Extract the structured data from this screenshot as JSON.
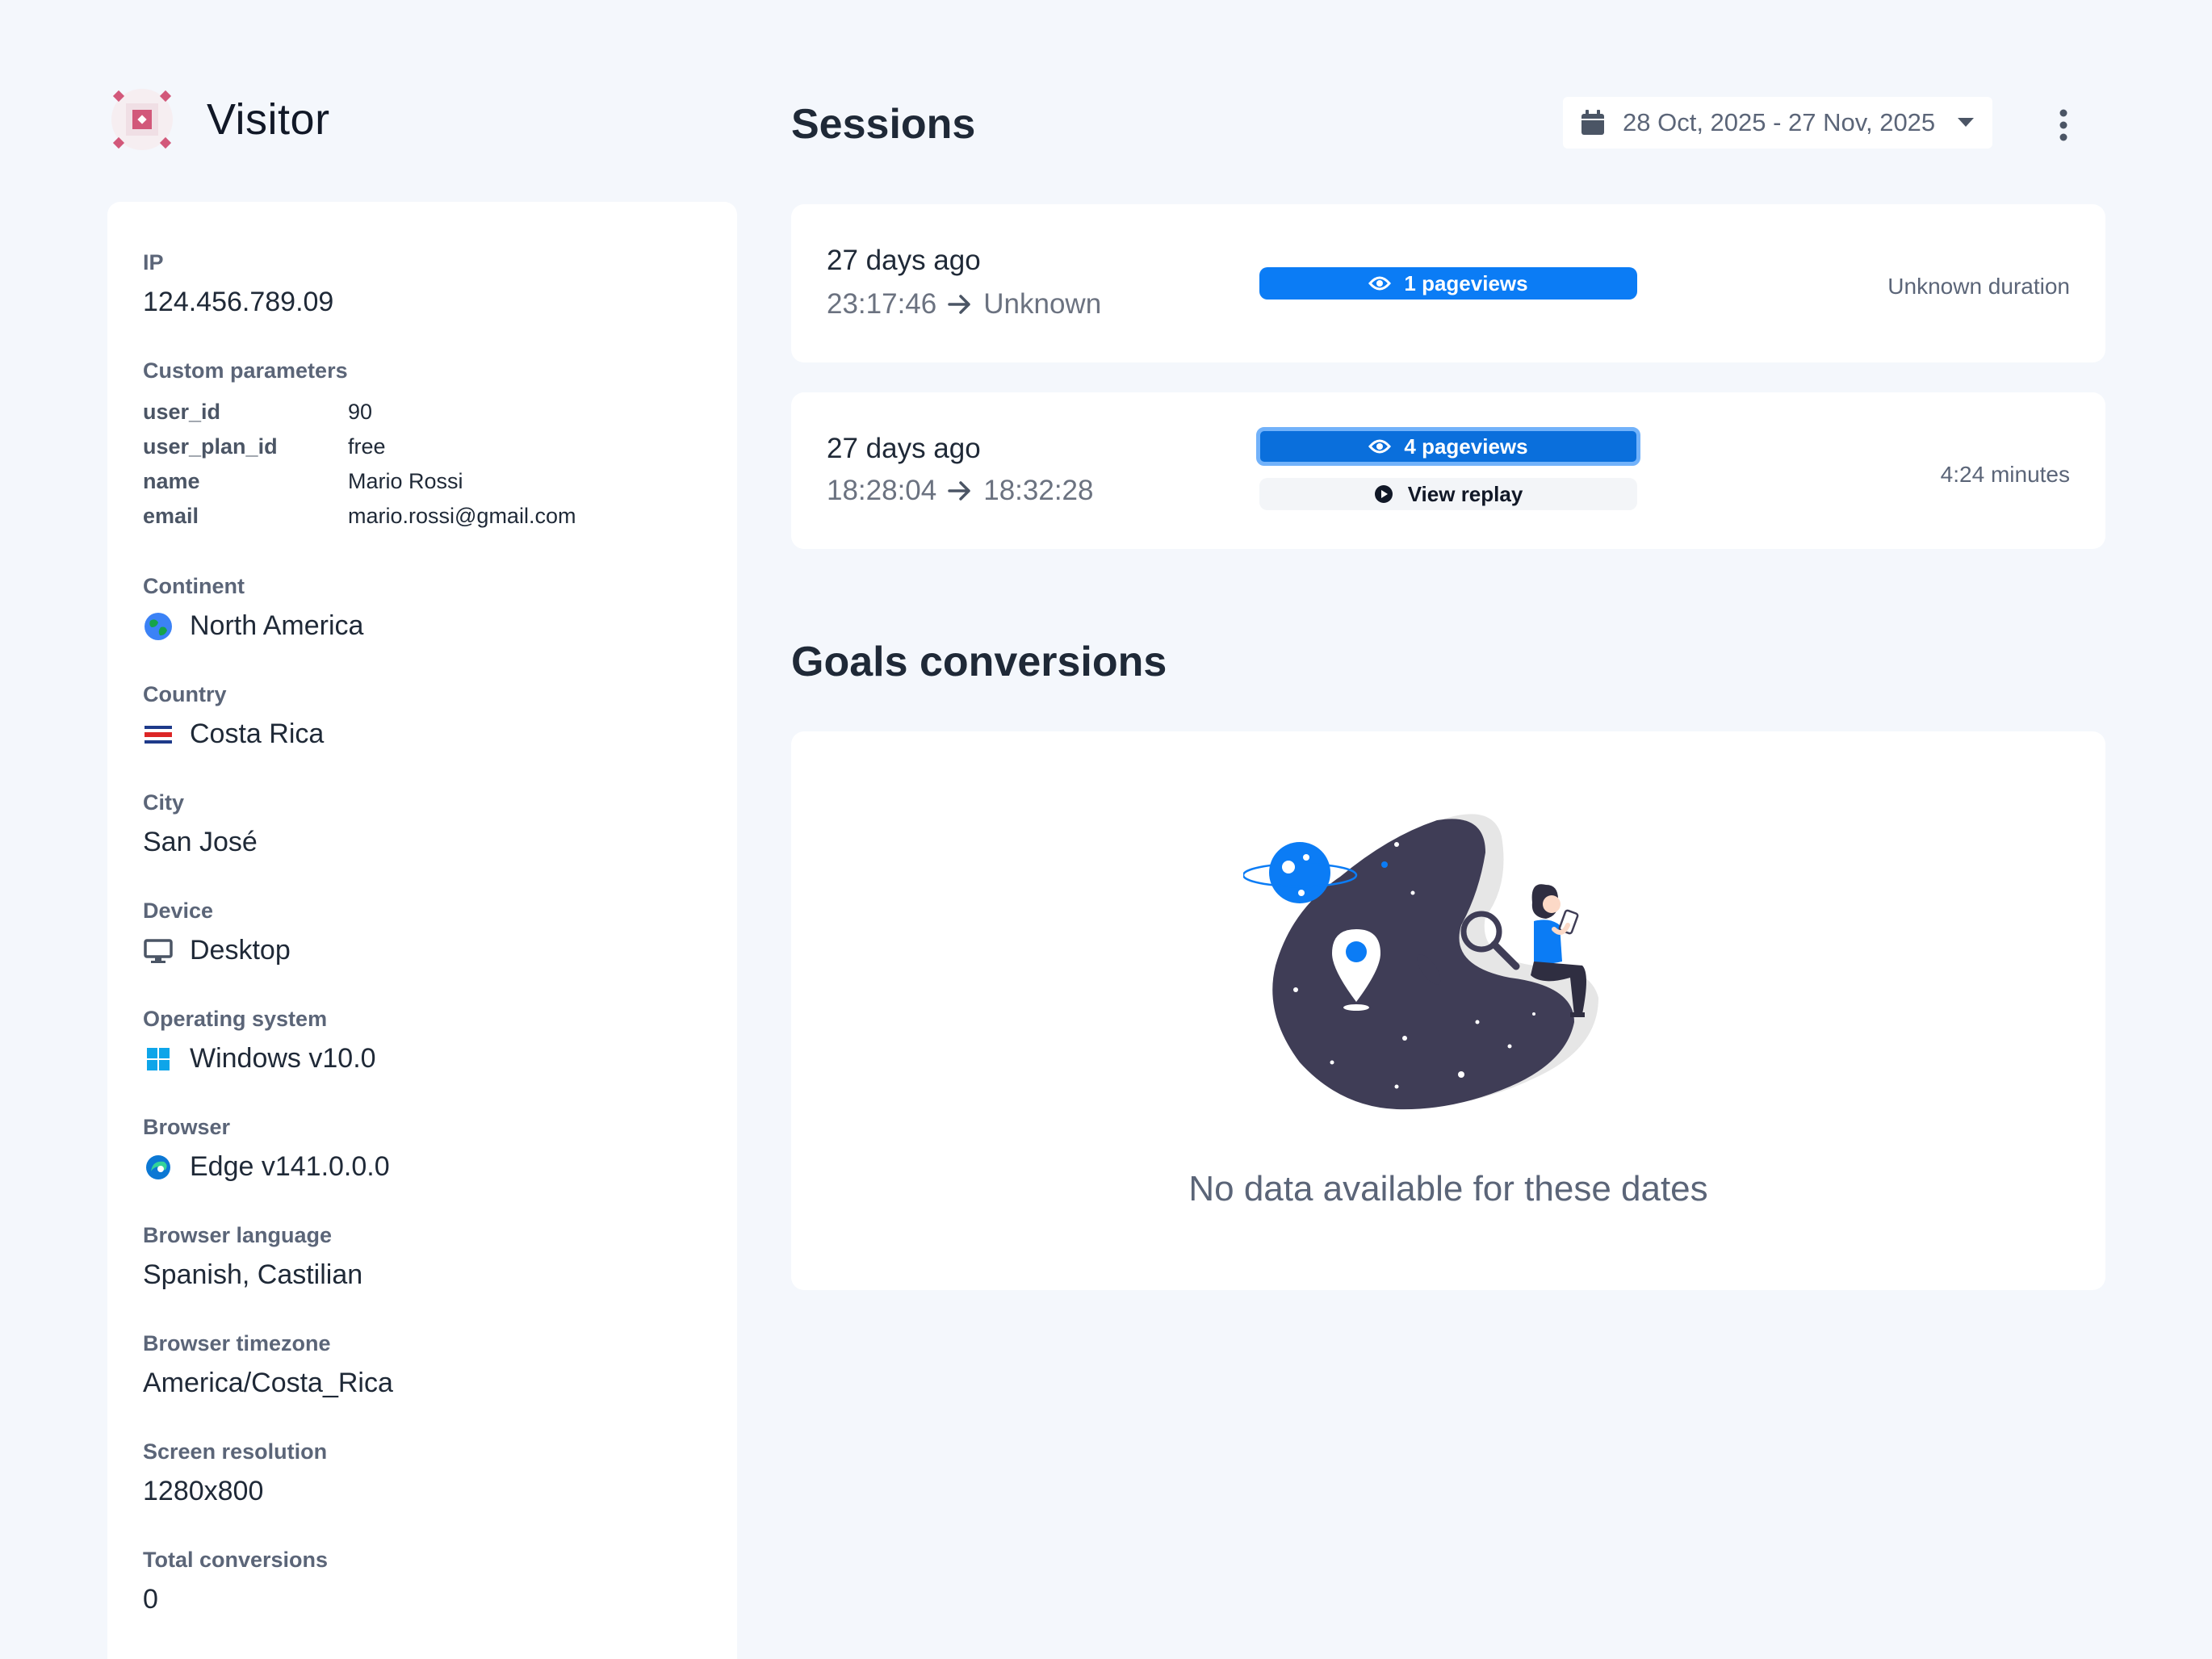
{
  "visitor": {
    "title": "Visitor"
  },
  "info": {
    "ip": {
      "label": "IP",
      "value": "124.456.789.09"
    },
    "custom_params": {
      "label": "Custom parameters",
      "rows": [
        {
          "key": "user_id",
          "value": "90"
        },
        {
          "key": "user_plan_id",
          "value": "free"
        },
        {
          "key": "name",
          "value": "Mario Rossi"
        },
        {
          "key": "email",
          "value": "mario.rossi@gmail.com"
        }
      ]
    },
    "continent": {
      "label": "Continent",
      "value": "North America",
      "icon": "globe-icon"
    },
    "country": {
      "label": "Country",
      "value": "Costa Rica",
      "icon": "costa-rica-flag-icon"
    },
    "city": {
      "label": "City",
      "value": "San José"
    },
    "device": {
      "label": "Device",
      "value": "Desktop",
      "icon": "desktop-icon"
    },
    "os": {
      "label": "Operating system",
      "value": "Windows v10.0",
      "icon": "windows-icon"
    },
    "browser": {
      "label": "Browser",
      "value": "Edge v141.0.0.0",
      "icon": "edge-icon"
    },
    "language": {
      "label": "Browser language",
      "value": "Spanish, Castilian"
    },
    "timezone": {
      "label": "Browser timezone",
      "value": "America/Costa_Rica"
    },
    "resolution": {
      "label": "Screen resolution",
      "value": "1280x800"
    },
    "conversions": {
      "label": "Total conversions",
      "value": "0"
    }
  },
  "sessions": {
    "title": "Sessions",
    "date_range": "28 Oct, 2025 - 27 Nov, 2025",
    "items": [
      {
        "ago": "27 days ago",
        "start": "23:17:46",
        "end": "Unknown",
        "pageviews": "1 pageviews",
        "duration": "Unknown duration"
      },
      {
        "ago": "27 days ago",
        "start": "18:28:04",
        "end": "18:32:28",
        "pageviews": "4 pageviews",
        "replay": "View replay",
        "duration": "4:24 minutes"
      }
    ]
  },
  "goals": {
    "title": "Goals conversions",
    "empty_text": "No data available for these dates"
  },
  "colors": {
    "accent": "#0b7cf5",
    "background": "#f4f7fc",
    "illustration_dark": "#3f3d56"
  }
}
